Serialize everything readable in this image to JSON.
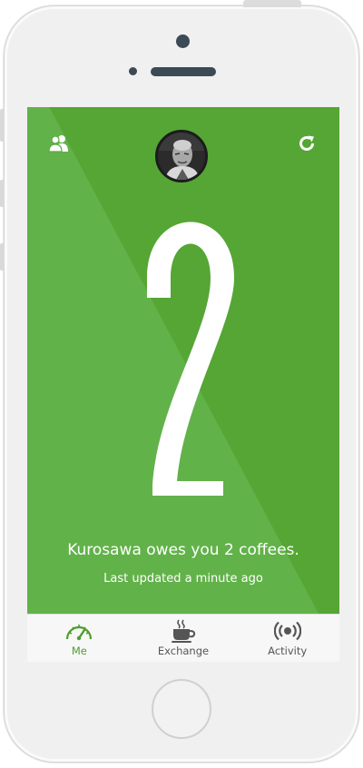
{
  "colors": {
    "accent": "#55a634",
    "accent_light": "#62b24a",
    "tab_active": "#4f9d2f",
    "tab_inactive": "#555555"
  },
  "header": {
    "left_icon": "friends-icon",
    "right_icon": "refresh-icon",
    "avatar_icon": "profile-photo"
  },
  "main": {
    "count": 2,
    "owes_message": "Kurosawa owes you 2 coffees.",
    "last_updated": "Last updated a minute ago"
  },
  "tabs": [
    {
      "label": "Me",
      "icon": "speedometer-icon",
      "active": true
    },
    {
      "label": "Exchange",
      "icon": "coffee-cup-icon",
      "active": false
    },
    {
      "label": "Activity",
      "icon": "broadcast-icon",
      "active": false
    }
  ]
}
